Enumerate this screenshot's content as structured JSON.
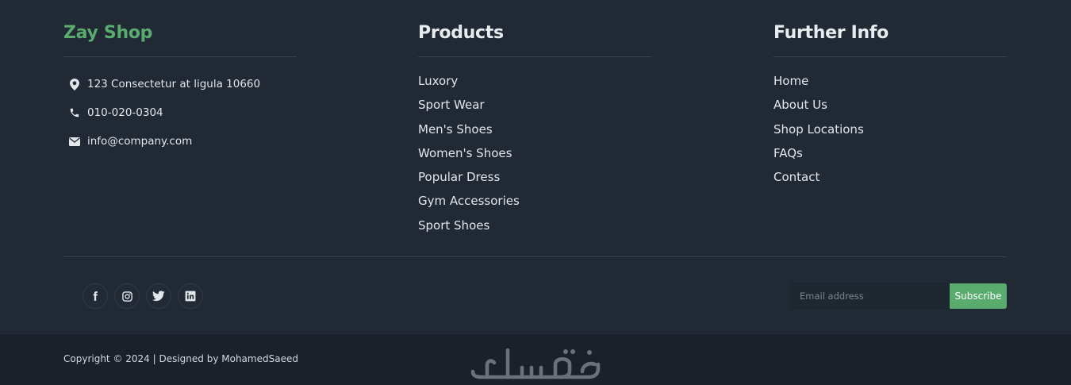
{
  "brand": {
    "title": "Zay Shop",
    "color": "#59ab6e"
  },
  "contact": [
    {
      "icon": "map-pin-icon",
      "text": "123 Consectetur at ligula 10660"
    },
    {
      "icon": "phone-icon",
      "text": "010-020-0304"
    },
    {
      "icon": "envelope-icon",
      "text": "info@company.com"
    }
  ],
  "products": {
    "title": "Products",
    "items": [
      "Luxory",
      "Sport Wear",
      "Men's Shoes",
      "Women's Shoes",
      "Popular Dress",
      "Gym Accessories",
      "Sport Shoes"
    ]
  },
  "further_info": {
    "title": "Further Info",
    "items": [
      "Home",
      "About Us",
      "Shop Locations",
      "FAQs",
      "Contact"
    ]
  },
  "social": [
    "facebook-icon",
    "instagram-icon",
    "twitter-icon",
    "linkedin-icon"
  ],
  "subscribe": {
    "placeholder": "Email address",
    "button_label": "Subscribe"
  },
  "footer": {
    "copyright": "Copyright © 2024 | Designed by MohamedSaeed",
    "watermark": "خمسات"
  },
  "colors": {
    "background": "#212934",
    "bottom_bar": "#1b212a",
    "accent": "#59ab6e"
  }
}
